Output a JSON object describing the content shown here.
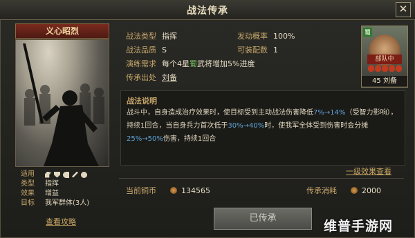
{
  "window": {
    "title": "战法传承",
    "close": "✕"
  },
  "card": {
    "name": "义心昭烈",
    "info": [
      {
        "label": "适用",
        "value": ""
      },
      {
        "label": "类型",
        "value": "指挥"
      },
      {
        "label": "效果",
        "value": "增益"
      },
      {
        "label": "目标",
        "value": "我军群体(3人)"
      }
    ],
    "troop_icons": [
      "cavalry-icon",
      "shield-icon",
      "bow-icon",
      "spear-icon",
      "wheel-icon"
    ],
    "guide": "查看攻略"
  },
  "details": {
    "type_label": "战法类型",
    "type_value": "指挥",
    "quality_label": "战法品质",
    "quality_value": "S",
    "prob_label": "发动概率",
    "prob_value": "100%",
    "slots_label": "可装配数",
    "slots_value": "1",
    "req_label": "演练需求",
    "req_pre": "每个4星",
    "req_faction": "蜀",
    "req_post": "武将增加5%进度",
    "source_label": "传承出处",
    "source_value": "刘备"
  },
  "hero": {
    "faction": "蜀",
    "role": "部队中",
    "level_name": "45 刘备",
    "stars": 5
  },
  "description": {
    "heading": "战法说明",
    "t1": "战斗中，自身造成治疗效果时，使目标受到主动战法伤害降低",
    "h1": "7%→14%",
    "t2": "（受智力影响），持续1回合，当自身兵力首次低于",
    "h2": "30%→40%",
    "t3": "时，使我军全体受到伤害时会分摊",
    "h3": "25%→50%",
    "t4": "伤害，持续1回合"
  },
  "effect_link": "一级效果查看",
  "cost": {
    "copper_label": "当前铜币",
    "copper_value": "134565",
    "inherit_label": "传承消耗",
    "inherit_value": "2000"
  },
  "button": "已传承",
  "watermark": "维普手游网"
}
